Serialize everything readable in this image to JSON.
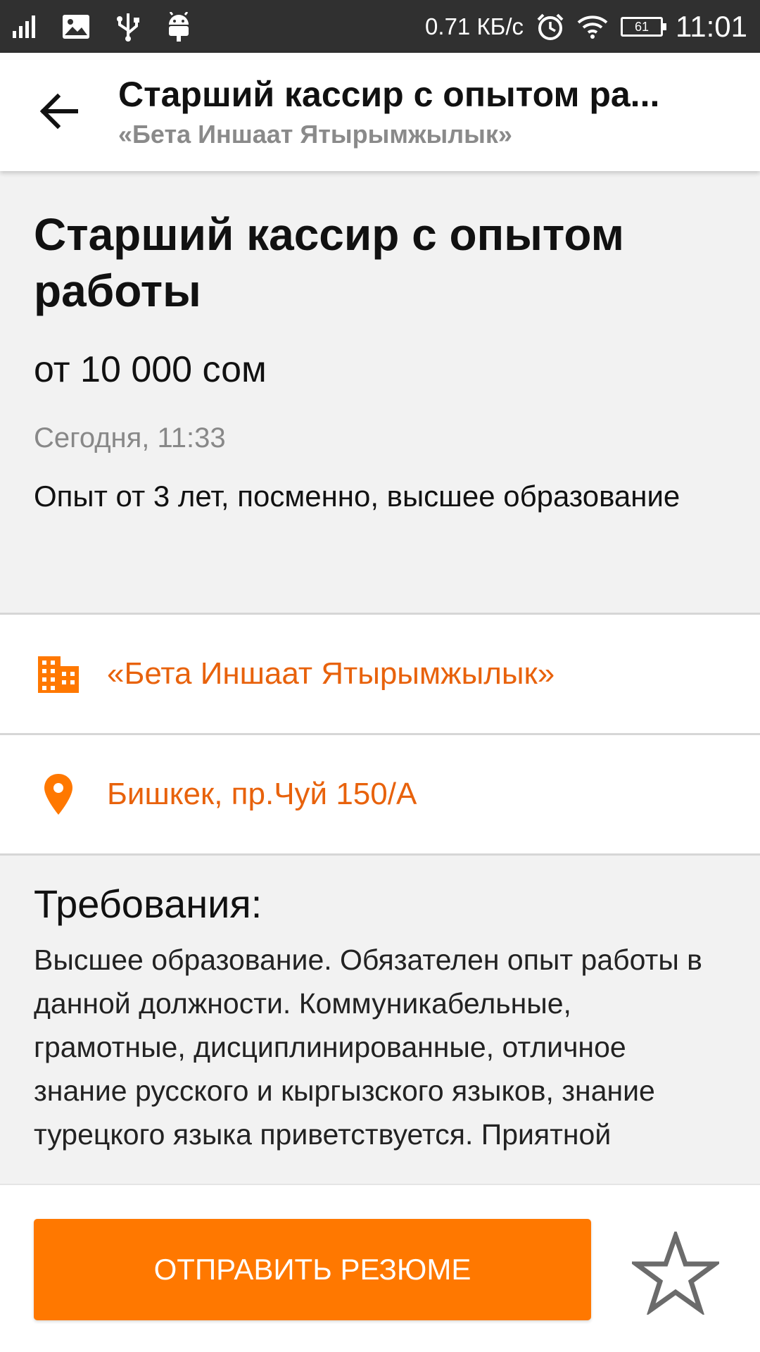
{
  "status_bar": {
    "speed": "0.71 КБ/с",
    "battery": "61",
    "time": "11:01"
  },
  "app_bar": {
    "title": "Старший кассир с опытом ра...",
    "subtitle": "«Бета Иншаат Ятырымжылык»"
  },
  "vacancy": {
    "title": "Старший кассир с опытом работы",
    "salary": "от 10 000 сом",
    "posted": "Сегодня, 11:33",
    "summary": "Опыт от 3 лет, посменно, высшее образование"
  },
  "company": {
    "name": "«Бета Иншаат Ятырымжылык»",
    "icon": "building-icon"
  },
  "location": {
    "address": "Бишкек, пр.Чуй 150/А",
    "icon": "location-pin-icon"
  },
  "requirements": {
    "heading": "Требования:",
    "text": "Высшее образование. Обязателен опыт работы в данной должности. Коммуникабельные, грамотные, дисциплинированные, отличное знание русского и кыргызского языков, знание турецкого языка приветствуется. Приятной"
  },
  "actions": {
    "send_resume": "ОТПРАВИТЬ РЕЗЮМЕ",
    "favorite_icon": "star-outline-icon"
  },
  "colors": {
    "accent": "#ff7800",
    "link": "#e8620c",
    "status_bar": "#303030"
  }
}
